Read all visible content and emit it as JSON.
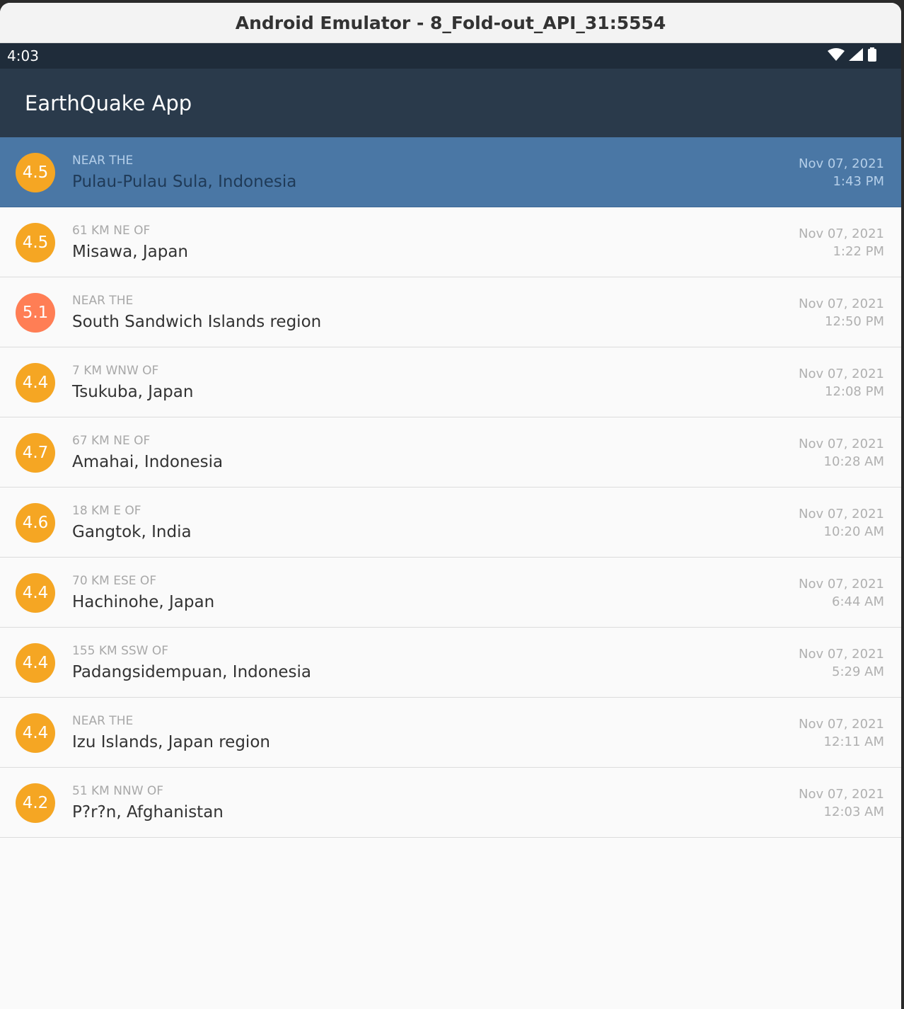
{
  "window": {
    "title": "Android Emulator - 8_Fold-out_API_31:5554"
  },
  "status_bar": {
    "time": "4:03",
    "icons": [
      "wifi-icon",
      "signal-icon",
      "battery-icon"
    ]
  },
  "app_bar": {
    "title": "EarthQuake App"
  },
  "colors": {
    "selected_row": "#4a77a5",
    "magnitude_moderate": "#f5a623",
    "magnitude_strong": "#ff7e55"
  },
  "earthquakes": [
    {
      "magnitude": "4.5",
      "offset": "NEAR THE",
      "place": "Pulau-Pulau Sula, Indonesia",
      "date": "Nov 07, 2021",
      "time": "1:43 PM",
      "color": "#f5a623",
      "selected": true
    },
    {
      "magnitude": "4.5",
      "offset": "61 KM NE OF",
      "place": "Misawa, Japan",
      "date": "Nov 07, 2021",
      "time": "1:22 PM",
      "color": "#f5a623",
      "selected": false
    },
    {
      "magnitude": "5.1",
      "offset": "NEAR THE",
      "place": "South Sandwich Islands region",
      "date": "Nov 07, 2021",
      "time": "12:50 PM",
      "color": "#ff7e55",
      "selected": false
    },
    {
      "magnitude": "4.4",
      "offset": "7 KM WNW OF",
      "place": "Tsukuba, Japan",
      "date": "Nov 07, 2021",
      "time": "12:08 PM",
      "color": "#f5a623",
      "selected": false
    },
    {
      "magnitude": "4.7",
      "offset": "67 KM NE OF",
      "place": "Amahai, Indonesia",
      "date": "Nov 07, 2021",
      "time": "10:28 AM",
      "color": "#f5a623",
      "selected": false
    },
    {
      "magnitude": "4.6",
      "offset": "18 KM E OF",
      "place": "Gangtok, India",
      "date": "Nov 07, 2021",
      "time": "10:20 AM",
      "color": "#f5a623",
      "selected": false
    },
    {
      "magnitude": "4.4",
      "offset": "70 KM ESE OF",
      "place": "Hachinohe, Japan",
      "date": "Nov 07, 2021",
      "time": "6:44 AM",
      "color": "#f5a623",
      "selected": false
    },
    {
      "magnitude": "4.4",
      "offset": "155 KM SSW OF",
      "place": "Padangsidempuan, Indonesia",
      "date": "Nov 07, 2021",
      "time": "5:29 AM",
      "color": "#f5a623",
      "selected": false
    },
    {
      "magnitude": "4.4",
      "offset": "NEAR THE",
      "place": "Izu Islands, Japan region",
      "date": "Nov 07, 2021",
      "time": "12:11 AM",
      "color": "#f5a623",
      "selected": false
    },
    {
      "magnitude": "4.2",
      "offset": "51 KM NNW OF",
      "place": "P?r?n, Afghanistan",
      "date": "Nov 07, 2021",
      "time": "12:03 AM",
      "color": "#f5a623",
      "selected": false
    }
  ]
}
